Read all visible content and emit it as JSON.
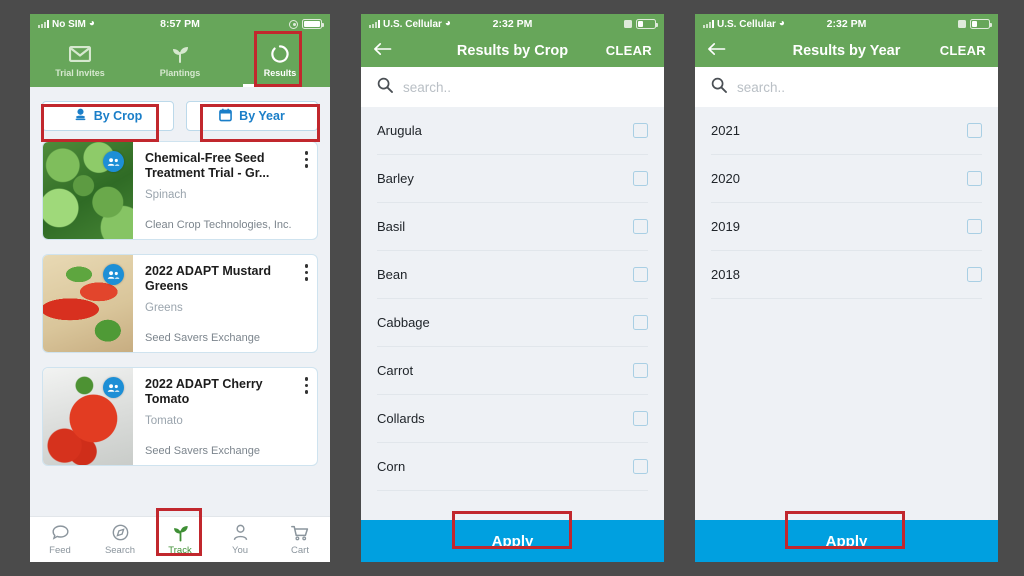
{
  "theme": {
    "green": "#67a65a",
    "blue_accent": "#1a7ec8",
    "apply_blue": "#00a0e0",
    "highlight_red": "#c1272d",
    "page_bg": "#eef1f5",
    "canvas_bg": "#4b4b4b",
    "badge_blue": "#1d8fd6",
    "checkbox_border": "#a9cfe4"
  },
  "phone1": {
    "status": {
      "carrier": "No SIM",
      "time": "8:57 PM",
      "wifi_icon": "wifi-icon",
      "battery_icon": "battery-icon",
      "lock-rotate_icon": "rotation-lock-icon"
    },
    "tabs": [
      {
        "label": "Trial Invites",
        "icon": "envelope-icon",
        "active": false
      },
      {
        "label": "Plantings",
        "icon": "seedling-icon",
        "active": false
      },
      {
        "label": "Results",
        "icon": "refresh-circle-icon",
        "active": true
      }
    ],
    "filters": [
      {
        "label": "By Crop",
        "icon": "crop-sprout-icon"
      },
      {
        "label": "By Year",
        "icon": "calendar-icon"
      }
    ],
    "cards": [
      {
        "title": "Chemical-Free Seed Treatment Trial - Gr...",
        "crop": "Spinach",
        "org": "Clean Crop Technologies, Inc.",
        "badge_icon": "group-people-icon",
        "menu_icon": "kebab-menu-icon",
        "image": "spinach-photo"
      },
      {
        "title": "2022 ADAPT Mustard Greens",
        "crop": "Greens",
        "org": "Seed Savers Exchange",
        "badge_icon": "group-people-icon",
        "menu_icon": "kebab-menu-icon",
        "image": "peppers-photo"
      },
      {
        "title": "2022 ADAPT Cherry Tomato",
        "crop": "Tomato",
        "org": "Seed Savers Exchange",
        "badge_icon": "group-people-icon",
        "menu_icon": "kebab-menu-icon",
        "image": "tomato-photo"
      }
    ],
    "bottom_nav": [
      {
        "label": "Feed",
        "icon": "chat-bubble-icon",
        "active": false
      },
      {
        "label": "Search",
        "icon": "compass-icon",
        "active": false
      },
      {
        "label": "Track",
        "icon": "seedling-icon",
        "active": true
      },
      {
        "label": "You",
        "icon": "person-icon",
        "active": false
      },
      {
        "label": "Cart",
        "icon": "shopping-cart-icon",
        "active": false
      }
    ]
  },
  "phone2": {
    "status": {
      "carrier": "U.S. Cellular",
      "time": "2:32 PM"
    },
    "navbar": {
      "back_icon": "back-arrow-icon",
      "title": "Results by Crop",
      "clear_label": "CLEAR"
    },
    "search": {
      "icon": "search-icon",
      "placeholder": "search.."
    },
    "rows": [
      {
        "label": "Arugula",
        "checked": false
      },
      {
        "label": "Barley",
        "checked": false
      },
      {
        "label": "Basil",
        "checked": false
      },
      {
        "label": "Bean",
        "checked": false
      },
      {
        "label": "Cabbage",
        "checked": false
      },
      {
        "label": "Carrot",
        "checked": false
      },
      {
        "label": "Collards",
        "checked": false
      },
      {
        "label": "Corn",
        "checked": false
      }
    ],
    "apply_label": "Apply"
  },
  "phone3": {
    "status": {
      "carrier": "U.S. Cellular",
      "time": "2:32 PM"
    },
    "navbar": {
      "back_icon": "back-arrow-icon",
      "title": "Results by Year",
      "clear_label": "CLEAR"
    },
    "search": {
      "icon": "search-icon",
      "placeholder": "search.."
    },
    "rows": [
      {
        "label": "2021",
        "checked": false
      },
      {
        "label": "2020",
        "checked": false
      },
      {
        "label": "2019",
        "checked": false
      },
      {
        "label": "2018",
        "checked": false
      }
    ],
    "apply_label": "Apply"
  }
}
